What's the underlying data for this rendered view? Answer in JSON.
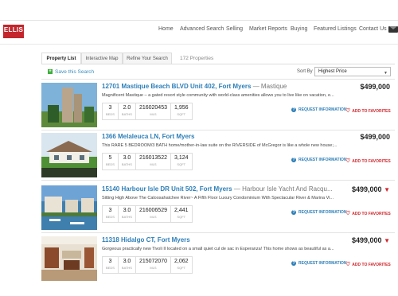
{
  "brand": {
    "logo": "ELLIS"
  },
  "nav": [
    "Home",
    "Advanced Search",
    "Selling",
    "Market Reports",
    "Buying",
    "Featured Listings",
    "Contact Us"
  ],
  "tabs": [
    "Property List",
    "Interactive Map",
    "Refine Your Search"
  ],
  "results_count": "172 Properties",
  "save_search": "Save this Search",
  "sort": {
    "label": "Sort By",
    "value": "Highest Price"
  },
  "actions": {
    "request": "REQUEST INFORMATION",
    "favorite": "ADD TO FAVORITES"
  },
  "stat_labels": {
    "beds": "BEDS",
    "baths": "BATHS",
    "mls": "MLS",
    "sqft": "SQFT"
  },
  "listings": [
    {
      "address": "12701 Mastique Beach BLVD Unit 402, Fort Myers",
      "community": " — Mastique",
      "price": "$499,000",
      "price_drop": false,
      "description": "Magnificent Mastique – a gated resort style community with world-class amenities allows you to live like on vacation, e...",
      "beds": "3",
      "baths": "2.0",
      "mls": "216020453",
      "sqft": "1,956"
    },
    {
      "address": "1366 Melaleuca LN, Fort Myers",
      "community": "",
      "price": "$499,000",
      "price_drop": false,
      "description": "This RARE 5 BEDROOM/3 BATH home/mother-in-law suite on the RIVERSIDE of McGregor is like a whole new house;...",
      "beds": "5",
      "baths": "3.0",
      "mls": "216013522",
      "sqft": "3,124"
    },
    {
      "address": "15140 Harbour Isle DR Unit 502, Fort Myers",
      "community": " — Harbour Isle Yacht And Racqu...",
      "price": "$499,000",
      "price_drop": true,
      "description": "Sitting High Above The Caloosahatchee River~ A Fifth Floor Luxury Condominium With Spectacular River & Marina Vi...",
      "beds": "3",
      "baths": "3.0",
      "mls": "216006529",
      "sqft": "2,441"
    },
    {
      "address": "11318 Hidalgo CT, Fort Myers",
      "community": "",
      "price": "$499,000",
      "price_drop": true,
      "description": "Gorgeous practically new Tivoli II located on a small quiet cul de sac in Esperanza! This home shows as beautiful as a...",
      "beds": "3",
      "baths": "3.0",
      "mls": "215072070",
      "sqft": "2,062"
    }
  ],
  "colors": {
    "accent": "#2d7fb8",
    "brand": "#c3262d",
    "price_drop": "#d0262c"
  }
}
